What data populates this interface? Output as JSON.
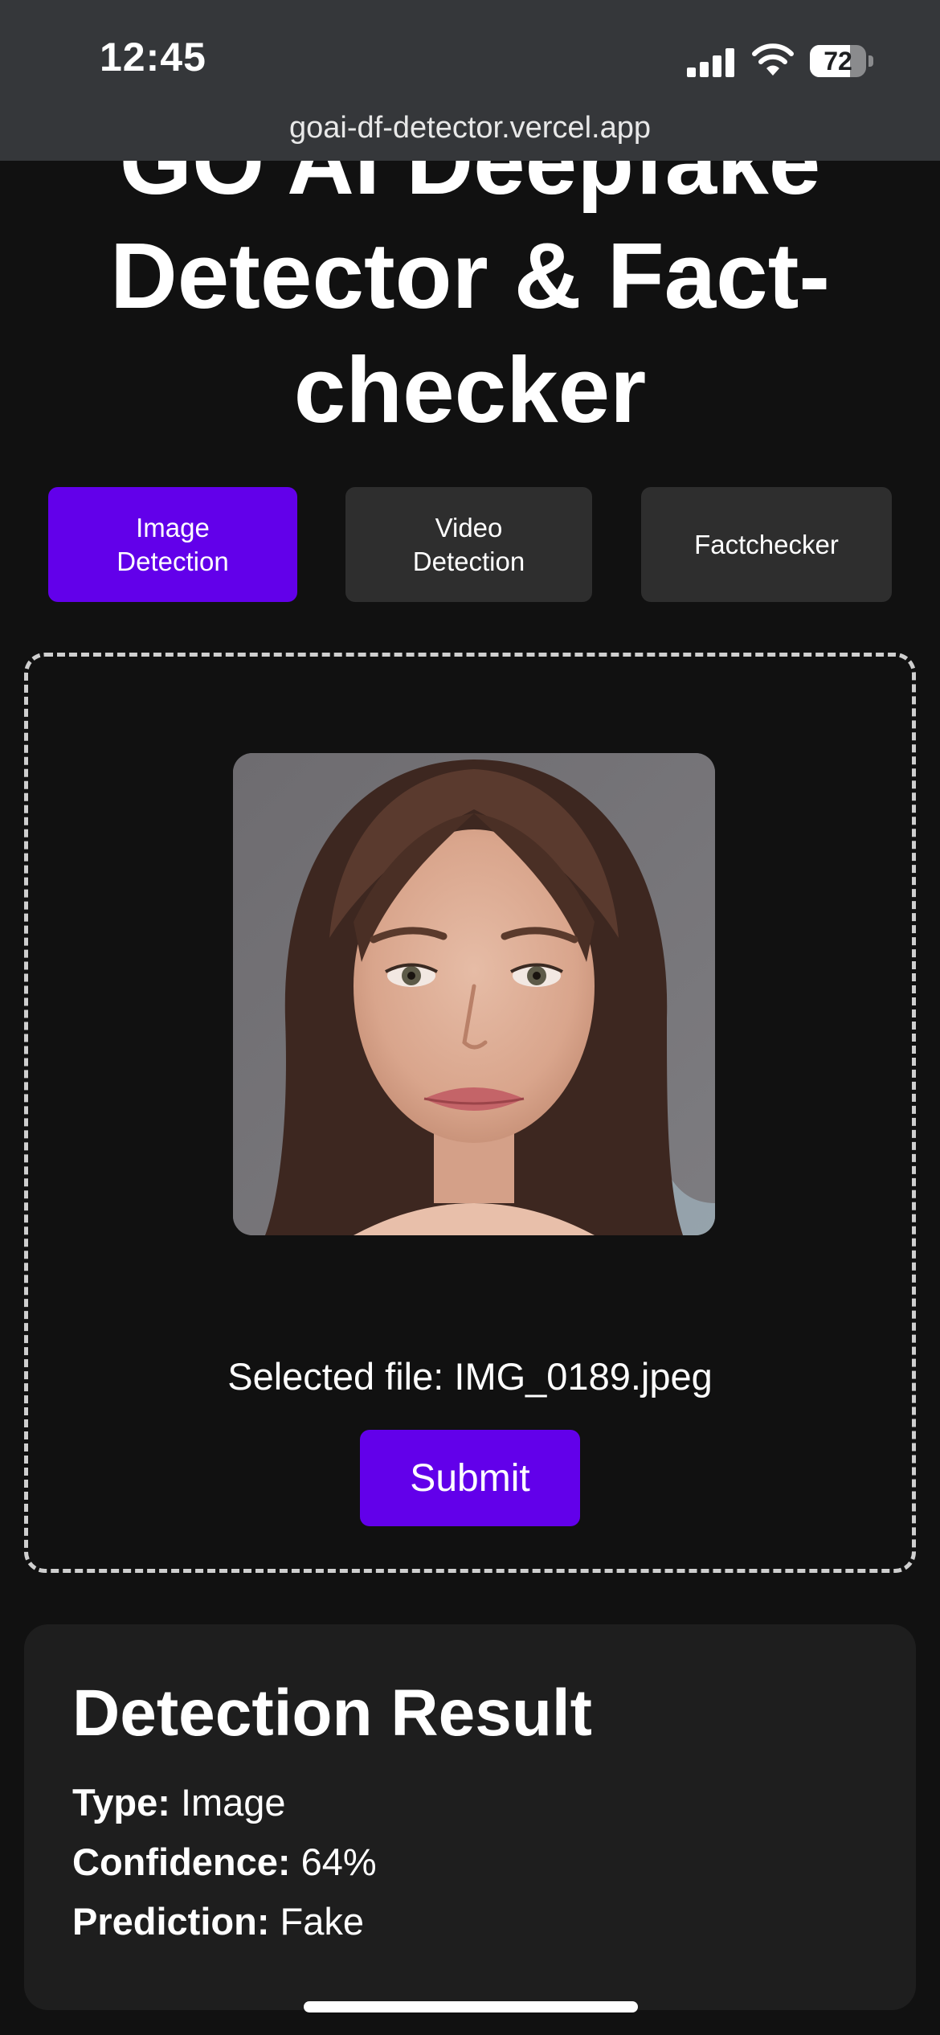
{
  "status_bar": {
    "time": "12:45",
    "battery": "72",
    "battery_level": 0.72
  },
  "browser": {
    "url": "goai-df-detector.vercel.app"
  },
  "hero": {
    "title_line1": "GO AI Deepfake",
    "title_line2": "Detector & Fact-",
    "title_line3": "checker"
  },
  "tabs": [
    {
      "label": "Image\nDetection",
      "active": true
    },
    {
      "label": "Video\nDetection",
      "active": false
    },
    {
      "label": "Factchecker",
      "active": false
    }
  ],
  "upload": {
    "selected_file": "Selected file: IMG_0189.jpeg",
    "submit_label": "Submit"
  },
  "result": {
    "title": "Detection Result",
    "type_label": "Type:",
    "type_value": "Image",
    "confidence_label": "Confidence:",
    "confidence_value": "64%",
    "prediction_label": "Prediction:",
    "prediction_value": "Fake"
  },
  "colors": {
    "accent": "#6200ea",
    "background": "#111111",
    "card": "#1e1e1e",
    "tab_inactive": "#2e2e2e",
    "browser_bar": "#35373a"
  }
}
